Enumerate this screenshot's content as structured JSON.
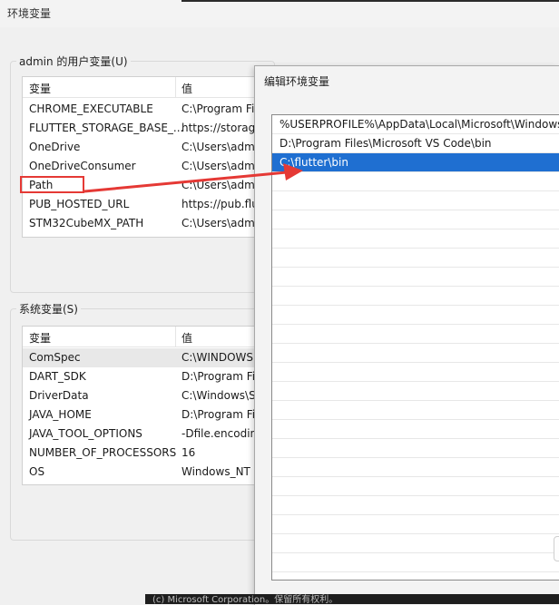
{
  "window": {
    "title": "环境变量"
  },
  "user_vars": {
    "legend": "admin 的用户变量(U)",
    "columns": [
      "变量",
      "值"
    ],
    "rows": [
      {
        "name": "CHROME_EXECUTABLE",
        "value": "C:\\Program Fi"
      },
      {
        "name": "FLUTTER_STORAGE_BASE_...",
        "value": "https://storag"
      },
      {
        "name": "OneDrive",
        "value": "C:\\Users\\adm"
      },
      {
        "name": "OneDriveConsumer",
        "value": "C:\\Users\\adm"
      },
      {
        "name": "Path",
        "value": "C:\\Users\\adm"
      },
      {
        "name": "PUB_HOSTED_URL",
        "value": "https://pub.flu"
      },
      {
        "name": "STM32CubeMX_PATH",
        "value": "C:\\Users\\adm"
      }
    ]
  },
  "system_vars": {
    "legend": "系统变量(S)",
    "columns": [
      "变量",
      "值"
    ],
    "rows": [
      {
        "name": "ComSpec",
        "value": "C:\\WINDOWS"
      },
      {
        "name": "DART_SDK",
        "value": "D:\\Program Fi"
      },
      {
        "name": "DriverData",
        "value": "C:\\Windows\\S"
      },
      {
        "name": "JAVA_HOME",
        "value": "D:\\Program Fi"
      },
      {
        "name": "JAVA_TOOL_OPTIONS",
        "value": "-Dfile.encodin"
      },
      {
        "name": "NUMBER_OF_PROCESSORS",
        "value": "16"
      },
      {
        "name": "OS",
        "value": "Windows_NT"
      }
    ]
  },
  "edit_dialog": {
    "title": "编辑环境变量",
    "entries": [
      "%USERPROFILE%\\AppData\\Local\\Microsoft\\WindowsApps",
      "D:\\Program Files\\Microsoft VS Code\\bin",
      "C:\\flutter\\bin"
    ],
    "selected_index": 2
  },
  "taskbar": {
    "text": "(c) Microsoft Corporation。保留所有权利。"
  },
  "colors": {
    "selection": "#1f6fd1",
    "annotation": "#e53935"
  }
}
